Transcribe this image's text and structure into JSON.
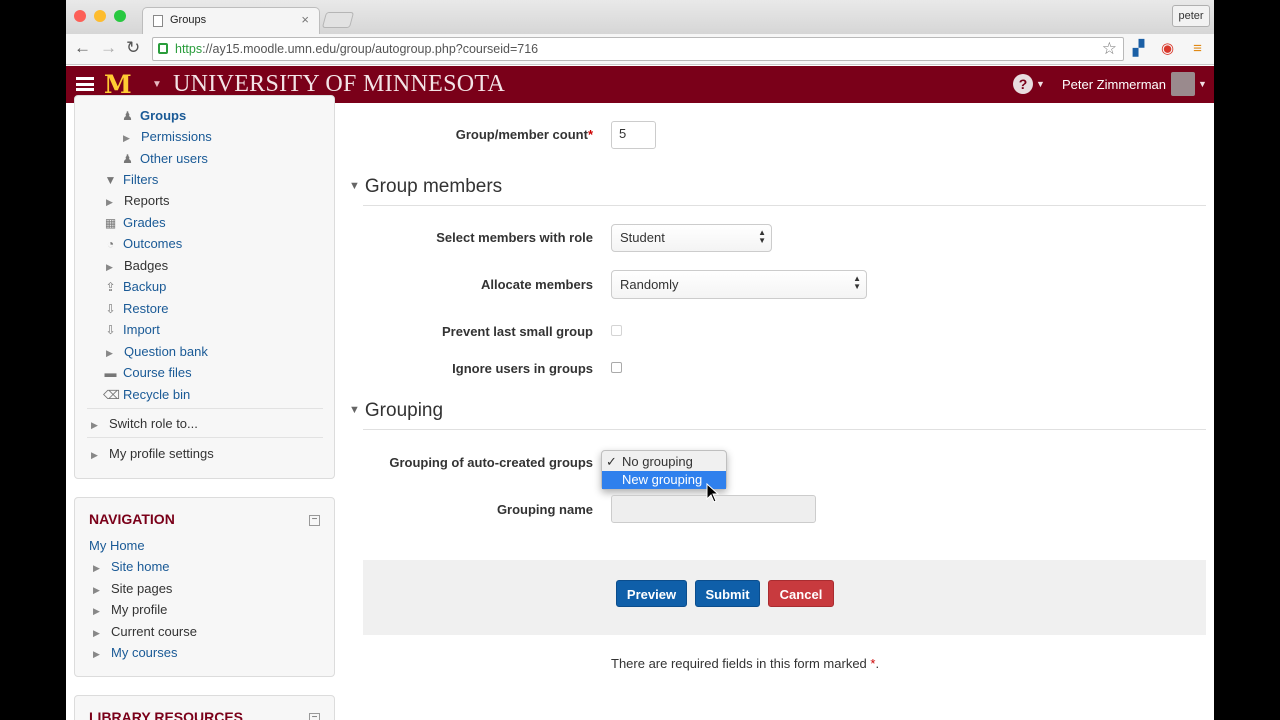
{
  "browser": {
    "tab_title": "Groups",
    "tab_close": "×",
    "profile_label": "peter",
    "url_scheme": "https",
    "url_rest": "://ay15.moodle.umn.edu/group/autogroup.php?courseid=716"
  },
  "header": {
    "logo": "M",
    "university": "UNIVERSITY OF MINNESOTA",
    "help": "?",
    "user_name": "Peter Zimmerman"
  },
  "admin_block": {
    "items": [
      {
        "label": "Groups",
        "icon": "group-icon"
      },
      {
        "label": "Permissions",
        "icon": "arrow"
      },
      {
        "label": "Other users",
        "icon": "user-icon"
      },
      {
        "label": "Filters",
        "icon": "filter-icon"
      },
      {
        "label": "Reports",
        "icon": "arrow"
      },
      {
        "label": "Grades",
        "icon": "grades-icon"
      },
      {
        "label": "Outcomes",
        "icon": "outcomes-icon"
      },
      {
        "label": "Badges",
        "icon": "arrow"
      },
      {
        "label": "Backup",
        "icon": "backup-icon"
      },
      {
        "label": "Restore",
        "icon": "restore-icon"
      },
      {
        "label": "Import",
        "icon": "import-icon"
      },
      {
        "label": "Question bank",
        "icon": "arrow"
      },
      {
        "label": "Course files",
        "icon": "folder-icon"
      },
      {
        "label": "Recycle bin",
        "icon": "recycle-icon"
      },
      {
        "label": "Switch role to...",
        "icon": "arrow"
      },
      {
        "label": "My profile settings",
        "icon": "arrow"
      }
    ]
  },
  "navigation": {
    "title": "NAVIGATION",
    "home": "My Home",
    "items": [
      "Site home",
      "Site pages",
      "My profile",
      "Current course",
      "My courses"
    ]
  },
  "library": {
    "title": "LIBRARY RESOURCES"
  },
  "form": {
    "count_label": "Group/member count",
    "required_mark": "*",
    "count_value": "5",
    "section_members": "Group members",
    "role_label": "Select members with role",
    "role_value": "Student",
    "allocate_label": "Allocate members",
    "allocate_value": "Randomly",
    "prevent_label": "Prevent last small group",
    "ignore_label": "Ignore users in groups",
    "section_grouping": "Grouping",
    "grouping_label": "Grouping of auto-created groups",
    "grouping_options": [
      "No grouping",
      "New grouping"
    ],
    "grouping_selected": "No grouping",
    "grouping_highlighted": "New grouping",
    "check_mark": "✓",
    "grouping_name_label": "Grouping name",
    "preview": "Preview",
    "submit": "Submit",
    "cancel": "Cancel",
    "required_note": "There are required fields in this form marked",
    "required_note_end": "."
  },
  "colors": {
    "maroon": "#7a0019",
    "gold": "#ffcc33",
    "link": "#1a5a96",
    "button_blue": "#0f5fa9",
    "button_red": "#c83a3e"
  }
}
